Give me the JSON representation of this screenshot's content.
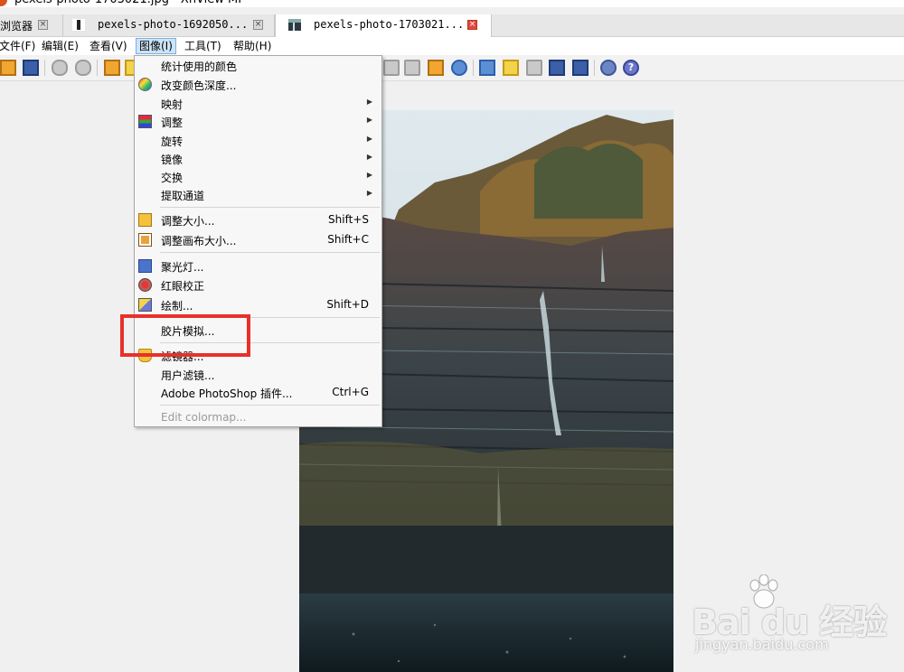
{
  "window": {
    "title": "pexels-photo-1703021.jpg - XnView MP"
  },
  "tabs": [
    {
      "label": "浏览器",
      "active": false
    },
    {
      "label": "pexels-photo-1692050...",
      "active": false
    },
    {
      "label": "pexels-photo-1703021...",
      "active": true
    }
  ],
  "menubar": [
    {
      "label": "文件(F)"
    },
    {
      "label": "编辑(E)"
    },
    {
      "label": "查看(V)"
    },
    {
      "label": "图像(I)"
    },
    {
      "label": "工具(T)"
    },
    {
      "label": "帮助(H)"
    }
  ],
  "image_menu": {
    "items": [
      {
        "label": "统计使用的颜色",
        "shortcut": "",
        "submenu": false,
        "icon": ""
      },
      {
        "label": "改变颜色深度...",
        "shortcut": "",
        "submenu": false,
        "icon": "palette-icon"
      },
      {
        "label": "映射",
        "shortcut": "",
        "submenu": true,
        "icon": ""
      },
      {
        "label": "调整",
        "shortcut": "",
        "submenu": true,
        "icon": "adjust-icon"
      },
      {
        "label": "旋转",
        "shortcut": "",
        "submenu": true,
        "icon": ""
      },
      {
        "label": "镜像",
        "shortcut": "",
        "submenu": true,
        "icon": ""
      },
      {
        "label": "交换",
        "shortcut": "",
        "submenu": true,
        "icon": ""
      },
      {
        "label": "提取通道",
        "shortcut": "",
        "submenu": true,
        "icon": ""
      },
      {
        "label": "调整大小...",
        "shortcut": "Shift+S",
        "submenu": false,
        "icon": "resize-icon"
      },
      {
        "label": "调整画布大小...",
        "shortcut": "Shift+C",
        "submenu": false,
        "icon": "canvas-size-icon"
      },
      {
        "label": "聚光灯...",
        "shortcut": "",
        "submenu": false,
        "icon": "spotlight-icon"
      },
      {
        "label": "红眼校正",
        "shortcut": "",
        "submenu": false,
        "icon": "red-eye-icon"
      },
      {
        "label": "绘制...",
        "shortcut": "Shift+D",
        "submenu": false,
        "icon": "draw-icon"
      },
      {
        "label": "胶片模拟...",
        "shortcut": "",
        "submenu": false,
        "icon": ""
      },
      {
        "label": "滤镜器...",
        "shortcut": "",
        "submenu": false,
        "icon": "filter-icon"
      },
      {
        "label": "用户滤镜...",
        "shortcut": "",
        "submenu": false,
        "icon": ""
      },
      {
        "label": "Adobe PhotoShop 插件...",
        "shortcut": "Ctrl+G",
        "submenu": false,
        "icon": ""
      },
      {
        "label": "Edit colormap...",
        "shortcut": "",
        "submenu": false,
        "icon": "",
        "disabled": true
      }
    ]
  },
  "watermark": {
    "brand": "Bai du 经验",
    "site": "jingyan.baidu.com"
  },
  "colors": {
    "highlight": "#e8302b",
    "menu_open": "#cde4f7"
  }
}
